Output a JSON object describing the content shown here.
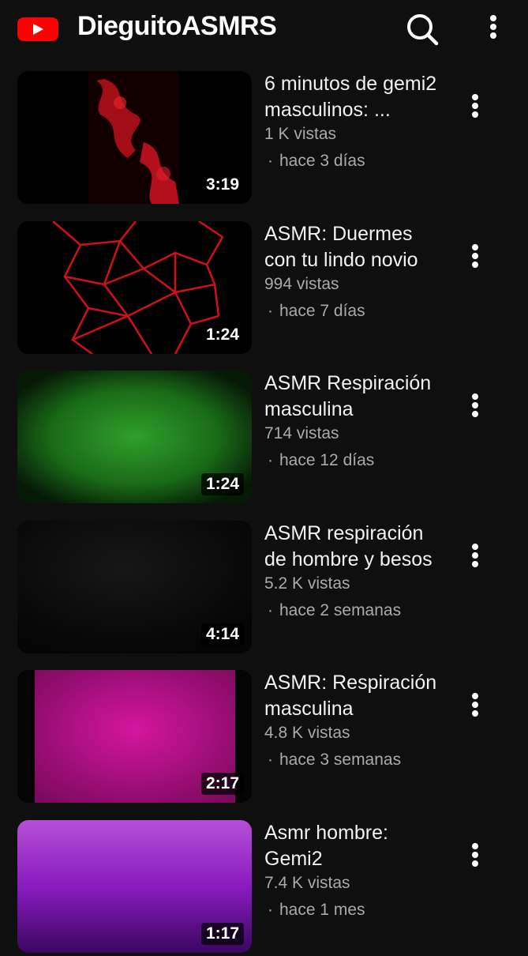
{
  "header": {
    "channel_name": "DieguitoASMRS",
    "logo_icon": "youtube-logo-icon",
    "search_icon": "search-icon",
    "menu_icon": "more-vertical-icon",
    "brand_color": "#ff0000"
  },
  "videos": [
    {
      "title": "6 minutos de gemi2 masculinos: ...",
      "views": "1 K vistas",
      "age": "hace 3 días",
      "duration": "3:19",
      "thumb_theme": "red-smoke"
    },
    {
      "title": "ASMR: Duermes con tu lindo novio",
      "views": "994 vistas",
      "age": "hace 7 días",
      "duration": "1:24",
      "thumb_theme": "red-web"
    },
    {
      "title": "ASMR Respiración masculina",
      "views": "714 vistas",
      "age": "hace 12 días",
      "duration": "1:24",
      "thumb_theme": "green-texture"
    },
    {
      "title": "ASMR respiración de hombre y besos",
      "views": "5.2 K vistas",
      "age": "hace 2 semanas",
      "duration": "4:14",
      "thumb_theme": "black"
    },
    {
      "title": "ASMR: Respiración masculina",
      "views": "4.8 K vistas",
      "age": "hace 3 semanas",
      "duration": "2:17",
      "thumb_theme": "magenta"
    },
    {
      "title": "Asmr hombre: Gemi2",
      "views": "7.4 K vistas",
      "age": "hace 1 mes",
      "duration": "1:17",
      "thumb_theme": "purple"
    }
  ],
  "separator": "·"
}
